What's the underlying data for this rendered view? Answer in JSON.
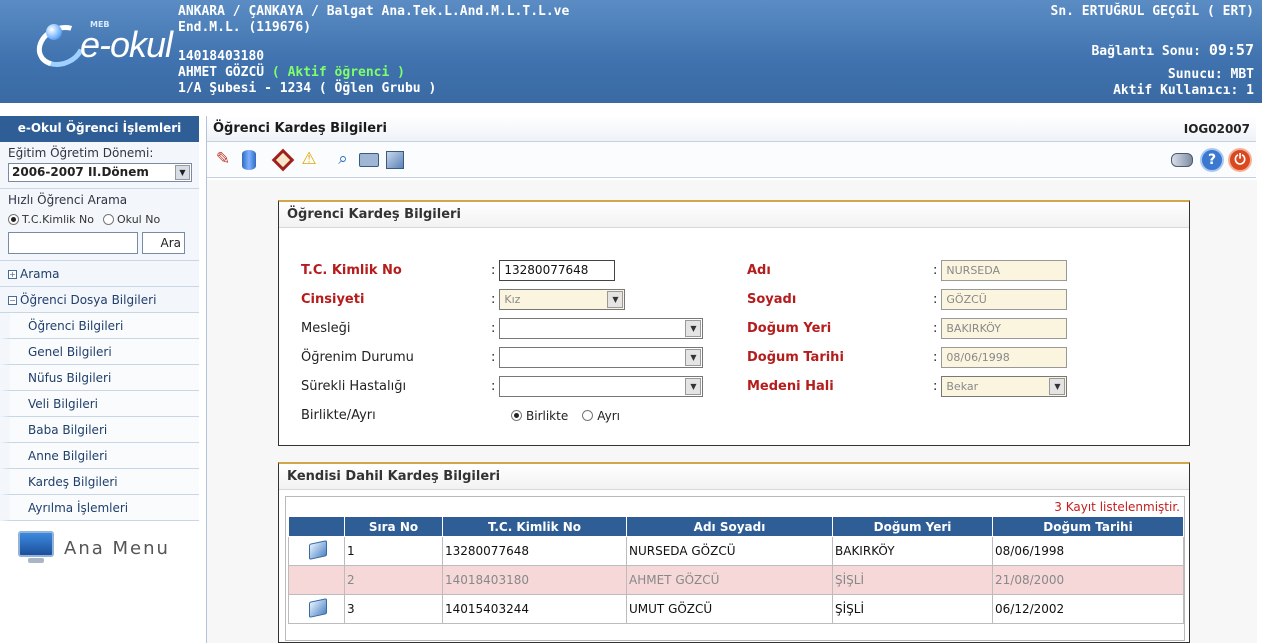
{
  "header": {
    "logo_word": "e-okul",
    "logo_meb": "MEB",
    "school_line1": "ANKARA / ÇANKAYA / Balgat Ana.Tek.L.And.M.L.T.L.ve",
    "school_line2": "End.M.L. (119676)",
    "student_tc": "14018403180",
    "student_name": "AHMET  GÖZCÜ",
    "student_status": "( Aktif öğrenci )",
    "student_class": "1/A Şubesi - 1234  ( Öğlen Grubu )",
    "user": "Sn. ERTUĞRUL GEÇGİL ( ERT)",
    "connection_label": "Bağlantı Sonu:",
    "connection_time": "09:57",
    "server": "Sunucu: MBT",
    "active_users": "Aktif Kullanıcı: 1"
  },
  "sidebar": {
    "title": "e-Okul Öğrenci İşlemleri",
    "term_label": "Eğitim Öğretim Dönemi:",
    "term_value": "2006-2007 II.Dönem",
    "quick_search_label": "Hızlı Öğrenci Arama",
    "radio_tc": "T.C.Kimlik No",
    "radio_school": "Okul No",
    "search_button": "Ara",
    "menu_search": "Arama",
    "menu_group": "Öğrenci Dosya Bilgileri",
    "items": [
      "Öğrenci Bilgileri",
      "Genel Bilgileri",
      "Nüfus Bilgileri",
      "Veli Bilgileri",
      "Baba Bilgileri",
      "Anne Bilgileri",
      "Kardeş Bilgileri",
      "Ayrılma İşlemleri"
    ],
    "ana_menu": "Ana Menu"
  },
  "page": {
    "title": "Öğrenci Kardeş Bilgileri",
    "code": "IOG02007"
  },
  "toolbar": {
    "icons": [
      "edit-icon",
      "save-icon",
      "delete-icon",
      "warning-icon",
      "search-icon",
      "print-icon",
      "transfer-icon"
    ],
    "right_icons": [
      "binoculars-icon",
      "help-icon",
      "exit-icon"
    ]
  },
  "form": {
    "title": "Öğrenci Kardeş Bilgileri",
    "tc_label": "T.C. Kimlik No",
    "tc_value": "13280077648",
    "gender_label": "Cinsiyeti",
    "gender_value": "Kız",
    "job_label": "Mesleği",
    "job_value": "",
    "edu_label": "Öğrenim Durumu",
    "edu_value": "",
    "illness_label": "Sürekli Hastalığı",
    "illness_value": "",
    "together_label": "Birlikte/Ayrı",
    "together_opt": "Birlikte",
    "apart_opt": "Ayrı",
    "name_label": "Adı",
    "name_value": "NURSEDA",
    "surname_label": "Soyadı",
    "surname_value": "GÖZCÜ",
    "birthplace_label": "Doğum Yeri",
    "birthplace_value": "BAKIRKÖY",
    "birthdate_label": "Doğum Tarihi",
    "birthdate_value": "08/06/1998",
    "marital_label": "Medeni Hali",
    "marital_value": "Bekar",
    "colon": ":"
  },
  "siblings": {
    "title": "Kendisi Dahil Kardeş Bilgileri",
    "count_text": "3 Kayıt listelenmiştir.",
    "headers": [
      "",
      "Sıra No",
      "T.C. Kimlik No",
      "Adı Soyadı",
      "Doğum Yeri",
      "Doğum Tarihi"
    ],
    "rows": [
      {
        "no": "1",
        "tc": "13280077648",
        "name": "NURSEDA GÖZCÜ",
        "place": "BAKIRKÖY",
        "date": "08/06/1998"
      },
      {
        "no": "2",
        "tc": "14018403180",
        "name": "AHMET GÖZCÜ",
        "place": "ŞİŞLİ",
        "date": "21/08/2000"
      },
      {
        "no": "3",
        "tc": "14015403244",
        "name": "UMUT GÖZCÜ",
        "place": "ŞİŞLİ",
        "date": "06/12/2002"
      }
    ]
  }
}
